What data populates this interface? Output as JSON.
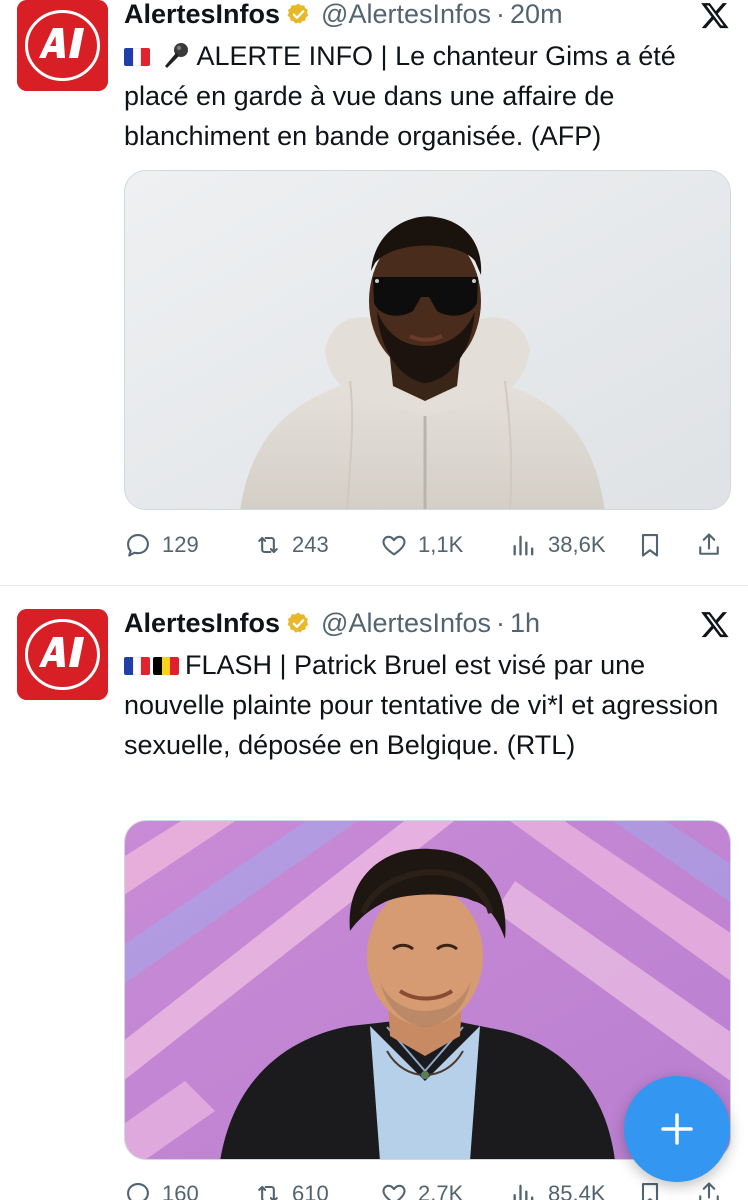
{
  "colors": {
    "brand_red": "#d81f26",
    "accent_blue": "#1d9bf0",
    "fab_blue": "#3396f0",
    "verified_gold": "#e8b829",
    "muted": "#536471",
    "text": "#0f1419"
  },
  "tweets": [
    {
      "avatar_icon": "alertesinfos-logo",
      "display_name": "AlertesInfos",
      "handle": "@AlertesInfos",
      "dot": "·",
      "time": "20m",
      "flags": [
        "france-flag"
      ],
      "emoji": "microphone",
      "text": "ALERTE INFO | Le chanteur Gims a été placé en garde à vue dans une affaire de blanchiment en bande organisée. (AFP)",
      "media": "photo-man-sunglasses-white-hoodie",
      "stats": {
        "replies": "129",
        "retweets": "243",
        "likes": "1,1K",
        "views": "38,6K"
      }
    },
    {
      "avatar_icon": "alertesinfos-logo",
      "display_name": "AlertesInfos",
      "handle": "@AlertesInfos",
      "dot": "·",
      "time": "1h",
      "flags": [
        "france-flag",
        "belgium-flag"
      ],
      "text": "FLASH | Patrick Bruel est visé par une nouvelle plainte pour tentative de vi*l et agression sexuelle, déposée en Belgique. (RTL)",
      "media": "photo-smiling-man-pink-background",
      "stats": {
        "replies": "160",
        "retweets": "610",
        "likes": "2,7K",
        "views": "85,4K"
      }
    }
  ],
  "fab": {
    "icon": "plus-icon"
  }
}
